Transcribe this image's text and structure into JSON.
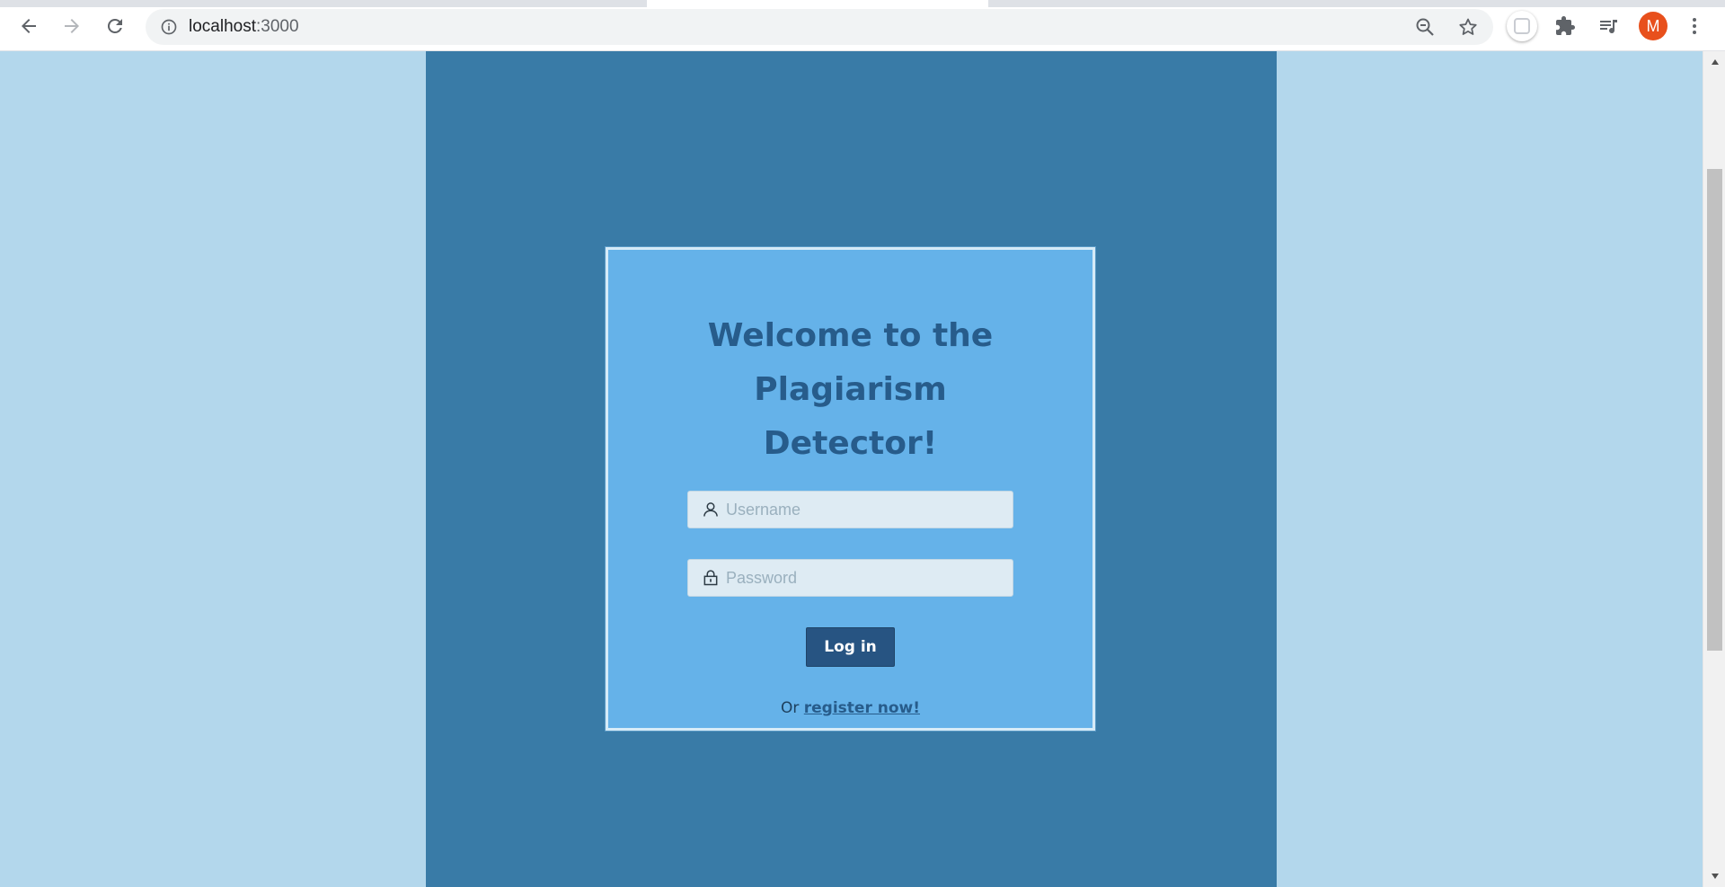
{
  "browser": {
    "url_host": "localhost",
    "url_port": ":3000",
    "profile_initial": "M",
    "icons": {
      "back": "arrow-left-icon",
      "forward": "arrow-right-icon",
      "reload": "reload-icon",
      "site_info": "info-icon",
      "zoom": "zoom-out-icon",
      "bookmark": "star-icon",
      "extension": "extension-app-icon",
      "extensions": "puzzle-icon",
      "media": "media-queue-icon",
      "menu": "kebab-menu-icon"
    },
    "avatar_color": "#e8501c"
  },
  "page": {
    "heading": "Welcome to the Plagiarism Detector!",
    "username_placeholder": "Username",
    "password_placeholder": "Password",
    "login_label": "Log in",
    "register_prefix": "Or",
    "register_link": "register now!"
  },
  "colors": {
    "outer_bg": "#b3d7ec",
    "column_bg": "#397ba7",
    "card_bg": "#65b2e9",
    "heading": "#275c8b",
    "button_bg": "#275482"
  }
}
